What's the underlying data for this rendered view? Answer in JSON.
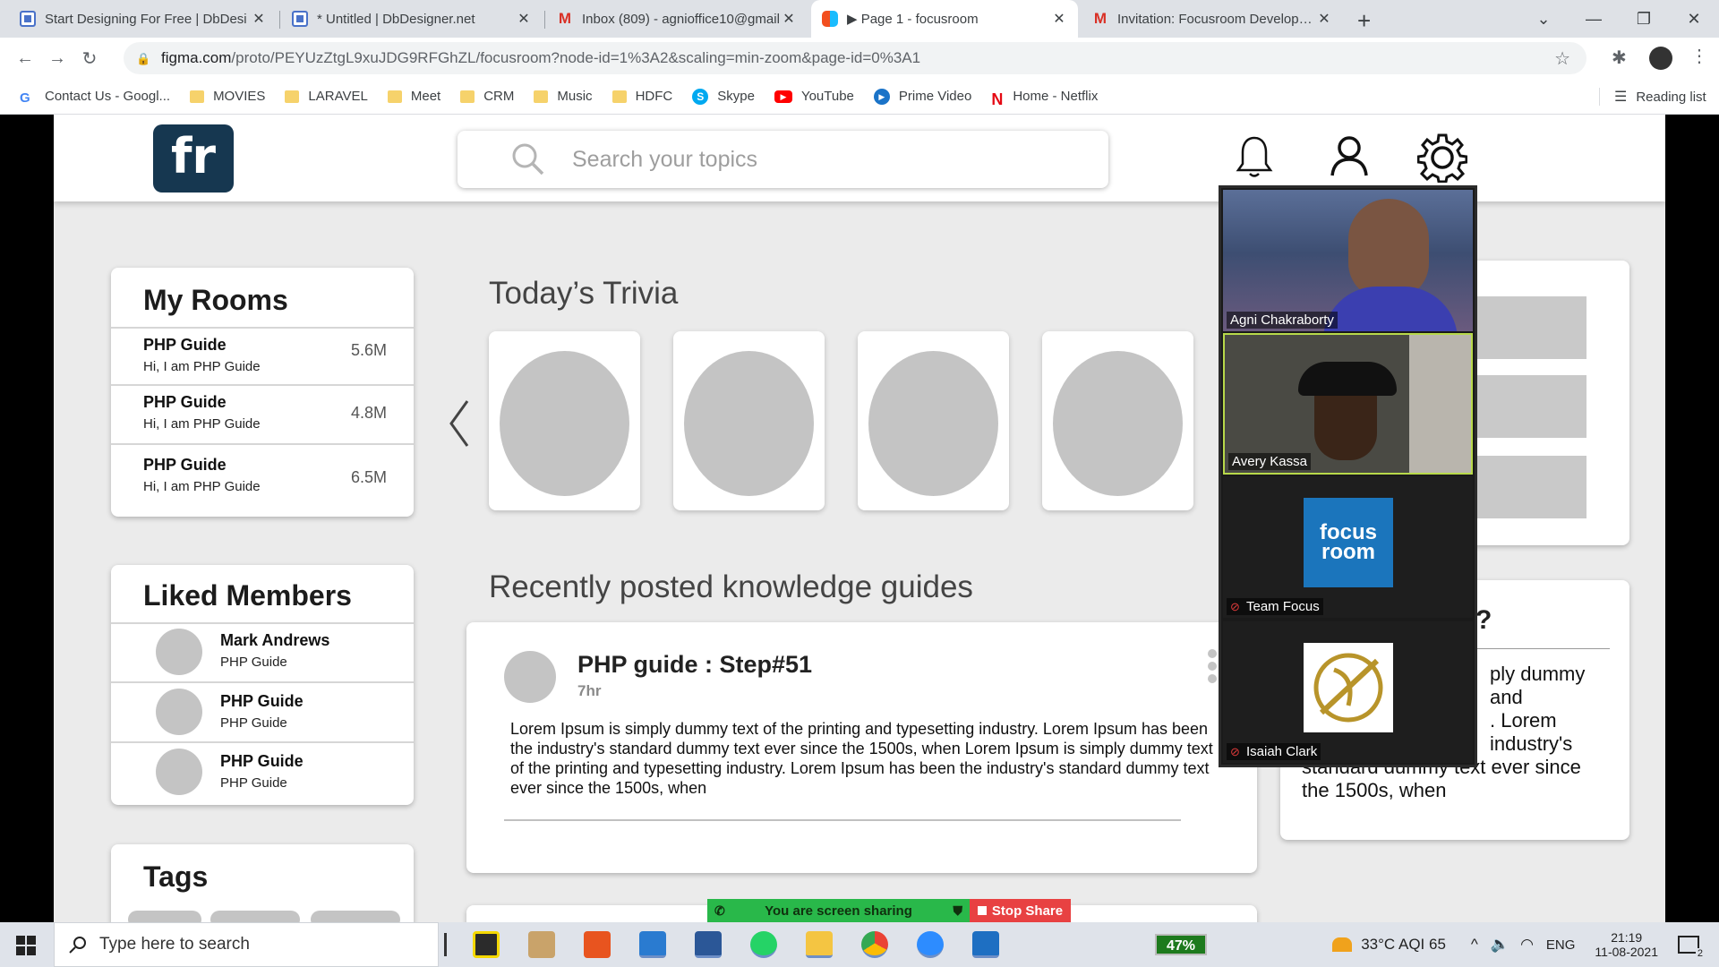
{
  "browser": {
    "tabs": [
      {
        "title": "Start Designing For Free | DbDesi",
        "icon": "dbdesigner-icon"
      },
      {
        "title": "* Untitled | DbDesigner.net",
        "icon": "dbdesigner-icon"
      },
      {
        "title": "Inbox (809) - agnioffice10@gmail",
        "icon": "gmail-icon"
      },
      {
        "title": "▶ Page 1 - focusroom",
        "icon": "figma-icon"
      },
      {
        "title": "Invitation: Focusroom Developme",
        "icon": "gmail-icon"
      }
    ],
    "url_main": "figma.com",
    "url_rest": "/proto/PEYUzZtgL9xuJDG9RFGhZL/focusroom?node-id=1%3A2&scaling=min-zoom&page-id=0%3A1",
    "bookmarks": [
      {
        "label": "Contact Us - Googl...",
        "icon": "google-icon"
      },
      {
        "label": "MOVIES",
        "icon": "folder-icon"
      },
      {
        "label": "LARAVEL",
        "icon": "folder-icon"
      },
      {
        "label": "Meet",
        "icon": "folder-icon"
      },
      {
        "label": "CRM",
        "icon": "folder-icon"
      },
      {
        "label": "Music",
        "icon": "folder-icon"
      },
      {
        "label": "HDFC",
        "icon": "folder-icon"
      },
      {
        "label": "Skype",
        "icon": "skype-icon"
      },
      {
        "label": "YouTube",
        "icon": "youtube-icon"
      },
      {
        "label": "Prime Video",
        "icon": "prime-video-icon"
      },
      {
        "label": "Home - Netflix",
        "icon": "netflix-icon"
      }
    ],
    "reading_list": "Reading list"
  },
  "site": {
    "logo_text": "fr",
    "search_placeholder": "Search your topics",
    "my_rooms": {
      "title": "My Rooms",
      "items": [
        {
          "title": "PHP Guide",
          "subtitle": "Hi, I am PHP Guide",
          "count": "5.6M"
        },
        {
          "title": "PHP Guide",
          "subtitle": "Hi, I am PHP Guide",
          "count": "4.8M"
        },
        {
          "title": "PHP Guide",
          "subtitle": "Hi, I am PHP Guide",
          "count": "6.5M"
        }
      ]
    },
    "liked_members": {
      "title": "Liked Members",
      "items": [
        {
          "name": "Mark Andrews",
          "subtitle": "PHP Guide"
        },
        {
          "name": "PHP Guide",
          "subtitle": "PHP Guide"
        },
        {
          "name": "PHP Guide",
          "subtitle": "PHP Guide"
        }
      ]
    },
    "tags_title": "Tags",
    "trivia_title": "Today’s Trivia",
    "guides_title": "Recently posted knowledge guides",
    "guide_post": {
      "title": "PHP guide : Step#51",
      "time": "7hr",
      "body": "Lorem Ipsum is simply dummy text of the printing and typesetting industry. Lorem Ipsum has been the industry's standard dummy text ever since the 1500s, when Lorem Ipsum is simply dummy text of the printing and typesetting industry. Lorem Ipsum has been the industry's standard dummy text ever since the 1500s, when"
    },
    "right_card": {
      "title_fragment": "?",
      "lines": [
        "ply dummy",
        "and",
        ". Lorem",
        "industry's",
        "standard dummy text ever since",
        "the 1500s, when"
      ]
    }
  },
  "zoom": {
    "participants": [
      {
        "name": "Agni Chakraborty",
        "muted": false
      },
      {
        "name": "Avery Kassa",
        "muted": false
      },
      {
        "name": "Team Focus",
        "muted": true,
        "logo_text": [
          "focus",
          "room"
        ]
      },
      {
        "name": "Isaiah Clark",
        "muted": true
      }
    ],
    "share_message": "You are screen sharing",
    "stop_label": "Stop Share"
  },
  "taskbar": {
    "search_placeholder": "Type here to search",
    "battery": "47%",
    "weather": "33°C  AQI 65",
    "language": "ENG",
    "time": "21:19",
    "date": "11-08-2021",
    "notifications": "2"
  }
}
